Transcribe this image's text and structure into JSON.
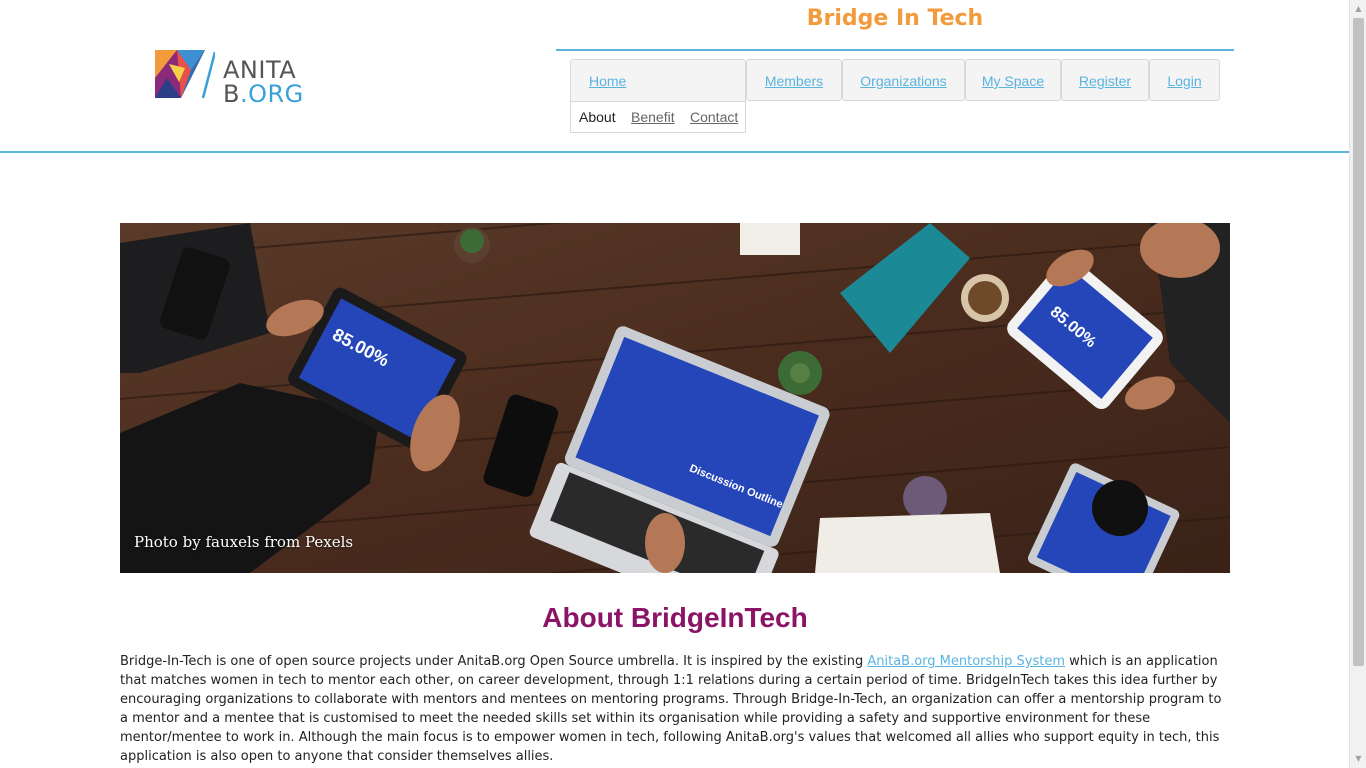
{
  "header": {
    "logo": {
      "line1": "ANITA",
      "line2_main": "B",
      "line2_org": ".ORG"
    },
    "site_title": "Bridge In Tech",
    "nav": {
      "home": "Home",
      "members": "Members",
      "organizations": "Organizations",
      "my_space": "My Space",
      "register": "Register",
      "login": "Login"
    },
    "subnav": {
      "about": "About",
      "benefit": "Benefit",
      "contact": "Contact"
    }
  },
  "hero": {
    "caption": "Photo by fauxels from Pexels",
    "screen_text_left": "85.00%",
    "screen_text_right": "85.00%",
    "screen_text_laptop": "Discussion Outline"
  },
  "about": {
    "title": "About BridgeInTech",
    "text_before_link": "Bridge-In-Tech is one of open source projects under AnitaB.org Open Source umbrella. It is inspired by the existing ",
    "link_text": "AnitaB.org Mentorship System",
    "text_after_link": " which is an application that matches women in tech to mentor each other, on career development, through 1:1 relations during a certain period of time. BridgeInTech takes this idea further by encouraging organizations to collaborate with mentors and mentees on mentoring programs. Through Bridge-In-Tech, an organization can offer a mentorship program to a mentor and a mentee that is customised to meet the needed skills set within its organisation while providing a safety and supportive environment for these mentor/mentee to work in. Although the main focus is to empower women in tech, following AnitaB.org's values that welcomed all allies who support equity in tech, this application is also open to anyone that consider themselves allies."
  },
  "colors": {
    "accent_blue": "#5ab4e0",
    "title_orange": "#f39a3a",
    "heading_magenta": "#8b1467"
  }
}
